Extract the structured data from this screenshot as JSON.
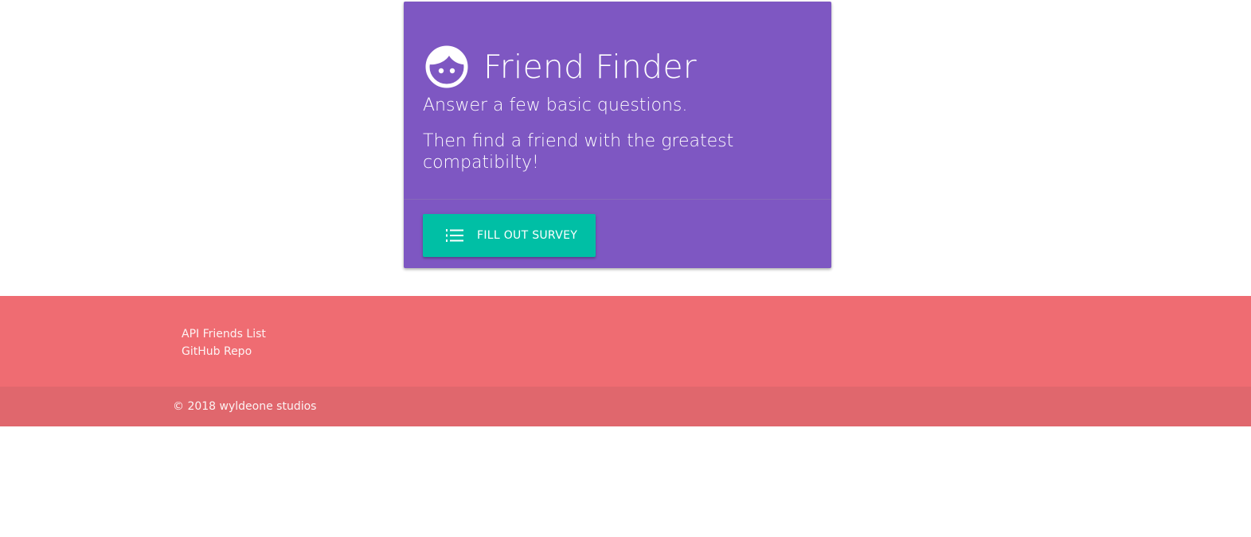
{
  "card": {
    "title": "Friend Finder",
    "title_icon": "face-icon",
    "tagline_1": "Answer a few basic questions.",
    "tagline_2": "Then find a friend with the greatest compatibilty!",
    "background_color": "#7e57c2"
  },
  "survey_button": {
    "label": "FILL OUT SURVEY",
    "icon": "format-list-numbered-icon",
    "color": "#00bfa5"
  },
  "footer": {
    "background_color": "#ef6c72",
    "links": [
      {
        "label": "API Friends List"
      },
      {
        "label": "GitHub Repo"
      }
    ],
    "copyright": "© 2018 wyldeone studios"
  }
}
